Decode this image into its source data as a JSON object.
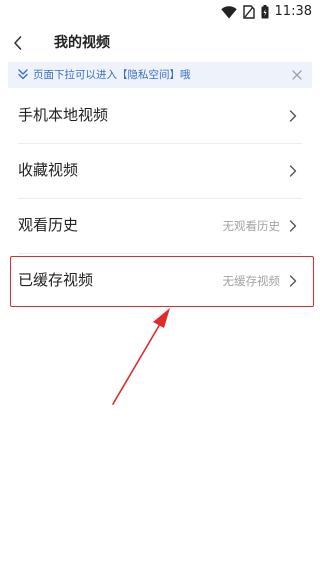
{
  "status_bar": {
    "time": "11:38",
    "icons": [
      "wifi-icon",
      "no-sim-icon",
      "battery-icon"
    ]
  },
  "header": {
    "title": "我的视频",
    "back_icon": "chevron-left-icon"
  },
  "notice": {
    "text": "页面下拉可以进入【隐私空间】哦",
    "icon": "double-chevron-down-icon",
    "close_icon": "close-icon",
    "color": "#3a6fc9",
    "background": "#eef3fb"
  },
  "menu": {
    "items": [
      {
        "label": "手机本地视频",
        "value": ""
      },
      {
        "label": "收藏视频",
        "value": ""
      },
      {
        "label": "观看历史",
        "value": "无观看历史"
      },
      {
        "label": "已缓存视频",
        "value": "无缓存视频"
      }
    ]
  },
  "annotation": {
    "highlight_color": "#e02b2b",
    "highlighted_item": "已缓存视频"
  }
}
